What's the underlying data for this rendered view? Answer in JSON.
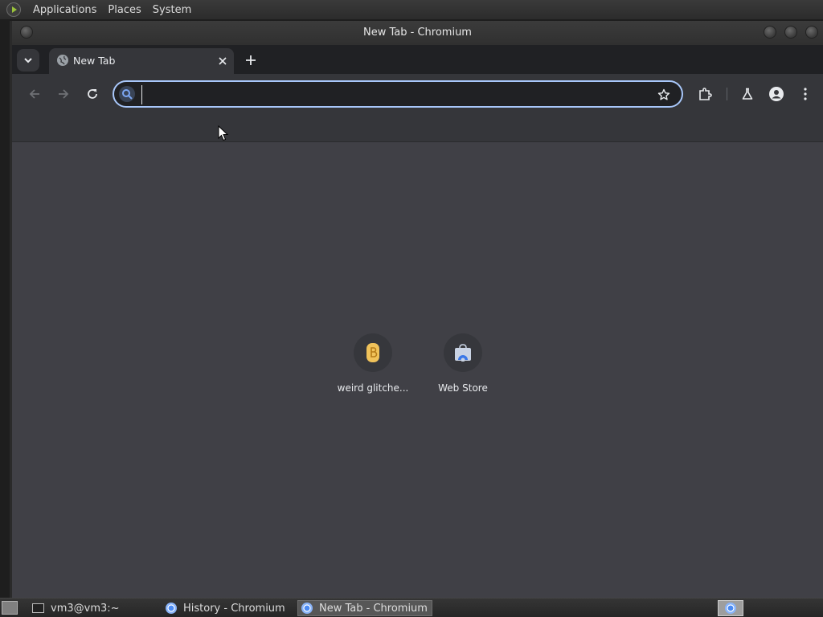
{
  "top_panel": {
    "menus": [
      "Applications",
      "Places",
      "System"
    ]
  },
  "window": {
    "title": "New Tab - Chromium"
  },
  "tabs": [
    {
      "title": "New Tab",
      "icon": "globe-icon",
      "active": true
    }
  ],
  "toolbar": {
    "address_value": "",
    "back_icon": "back-arrow-icon",
    "forward_icon": "forward-arrow-icon",
    "reload_icon": "reload-icon",
    "bookmark_icon": "star-icon",
    "extensions_icon": "puzzle-icon",
    "labs_icon": "flask-icon",
    "profile_icon": "person-icon",
    "menu_icon": "kebab-menu-icon"
  },
  "shortcuts": [
    {
      "label": "weird glitche...",
      "icon": "glitch-b-icon"
    },
    {
      "label": "Web Store",
      "icon": "web-store-icon"
    }
  ],
  "taskbar": {
    "tasks": [
      {
        "label": "vm3@vm3:~",
        "icon": "terminal-icon",
        "active": false
      },
      {
        "label": "History - Chromium",
        "icon": "chromium-icon",
        "active": false
      },
      {
        "label": "New Tab - Chromium",
        "icon": "chromium-icon",
        "active": true
      }
    ]
  },
  "colors": {
    "page_background": "#404046",
    "toolbar_background": "#35363a",
    "tabstrip_background": "#202124",
    "omnibox_focus_ring": "#a8c7fa"
  }
}
